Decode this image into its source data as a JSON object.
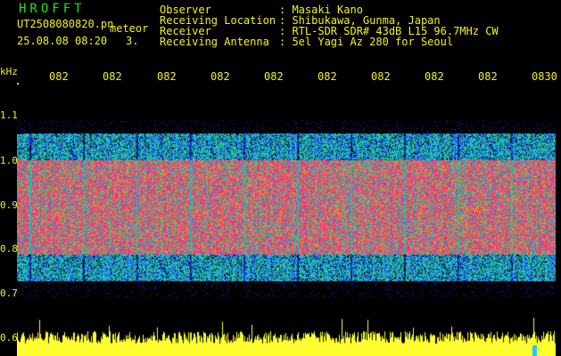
{
  "header": {
    "brand": "HROFFT",
    "filename": "UT2508080820.pn",
    "tag": "meteor",
    "datetime": "25.08.08 08:20",
    "counter": "3.",
    "info": [
      {
        "label": "Observer",
        "value": ": Masaki Kano"
      },
      {
        "label": "Receiving Location",
        "value": ": Shibukawa, Gunma, Japan"
      },
      {
        "label": "Receiver",
        "value": ": RTL-SDR SDR# 43dB L15 96.7MHz CW"
      },
      {
        "label": "Receiving Antenna",
        "value": ": 5el Yagi Az 280 for Seoul"
      }
    ]
  },
  "axis": {
    "y_unit": "kHz",
    "y_ticks": [
      "1.1",
      "1.0",
      "0.9",
      "0.8",
      "0.7",
      "0.6"
    ],
    "x_ticks": [
      "082",
      "082",
      "082",
      "082",
      "082",
      "082",
      "082",
      "082",
      "082",
      "0830"
    ]
  },
  "colors": {
    "text_header": "#18e818",
    "text_axis": "#f2f21a",
    "background": "#000000",
    "signal_core": "#ff2a7a",
    "signal_mid": "#2ad17a",
    "signal_edge": "#1a40ff",
    "power_trace": "#ffff30"
  }
}
